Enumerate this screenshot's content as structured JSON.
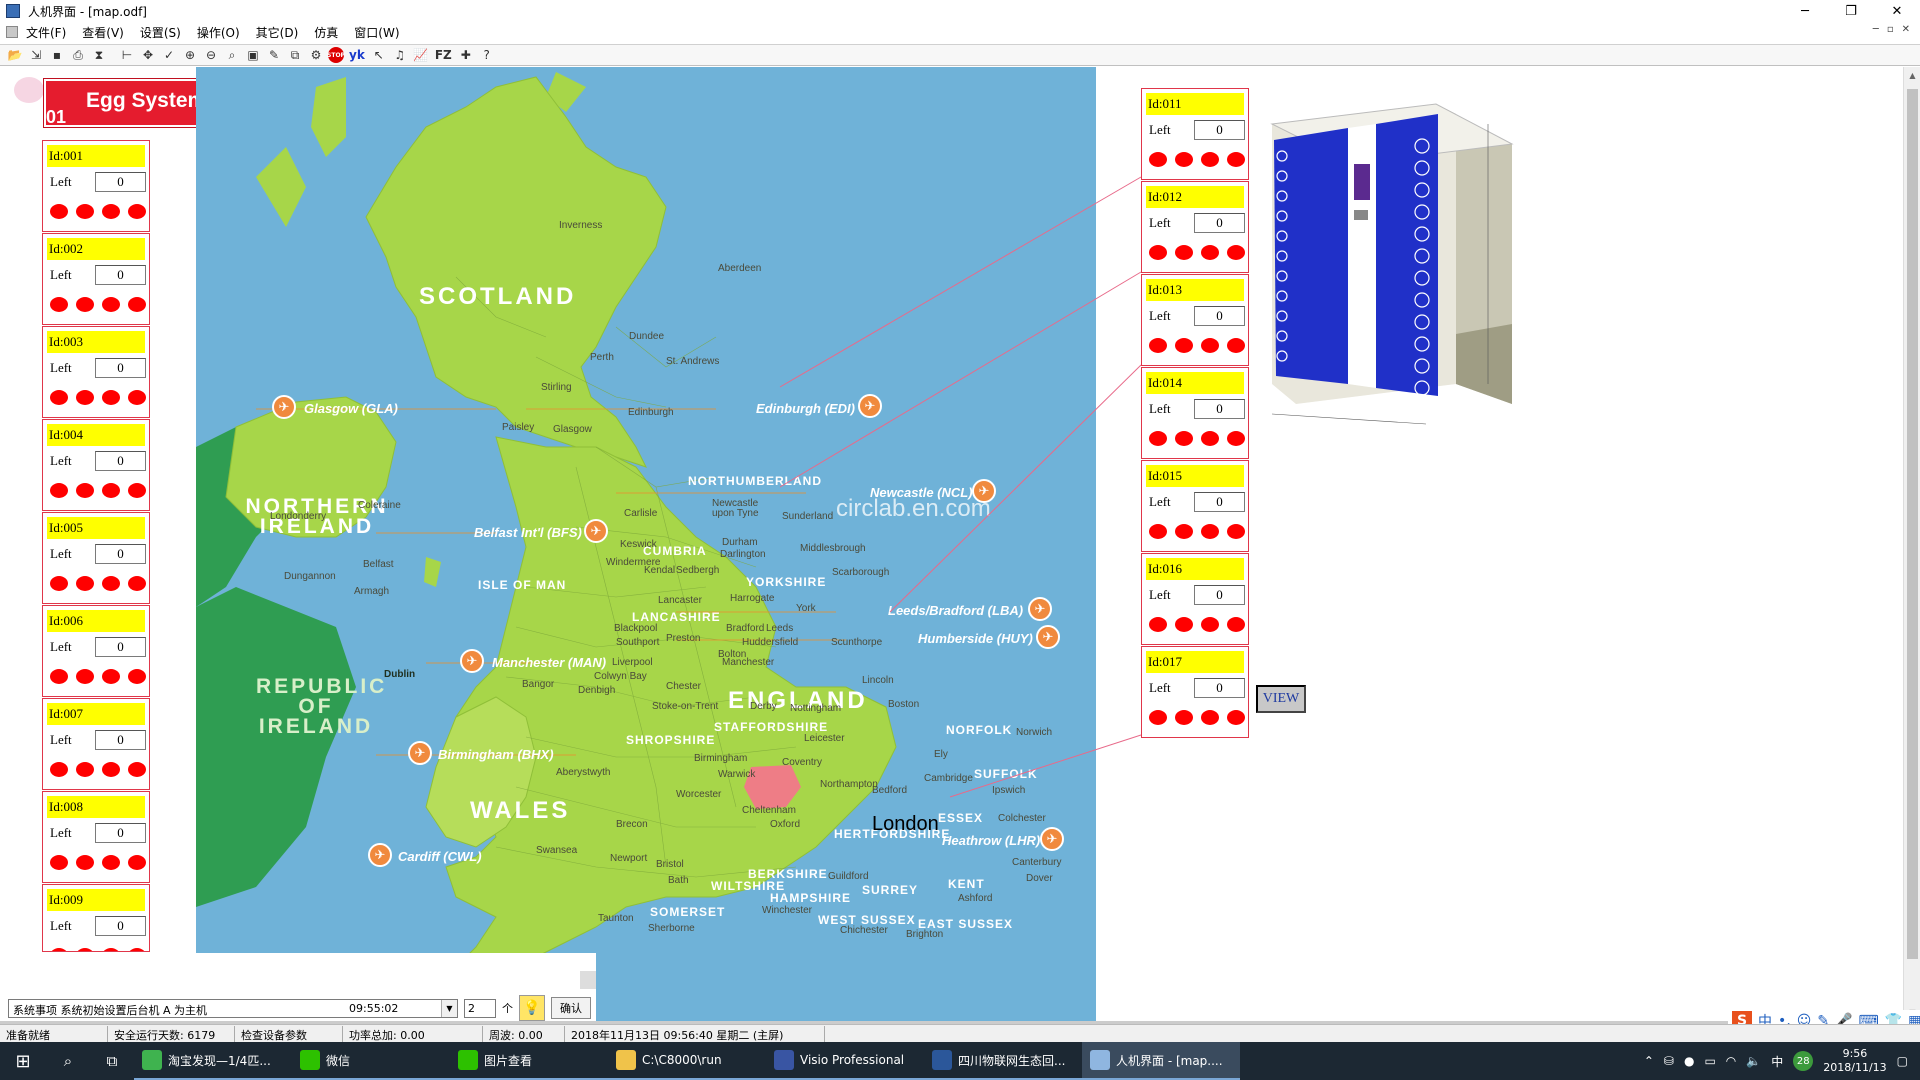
{
  "window": {
    "title": "人机界面 - [map.odf]",
    "controls": [
      "─",
      "❐",
      "✕"
    ]
  },
  "menu": [
    "文件(F)",
    "查看(V)",
    "设置(S)",
    "操作(O)",
    "其它(D)",
    "仿真",
    "窗口(W)"
  ],
  "mdi_controls": [
    "─",
    "▫",
    "✕"
  ],
  "toolbar": {
    "stop_label": "STOP",
    "yk_label": "yk",
    "fz_label": "FZ"
  },
  "logo": {
    "title": "Egg System",
    "badge": "01"
  },
  "left_panels": [
    {
      "id": "Id:001",
      "left_label": "Left",
      "value": "0"
    },
    {
      "id": "Id:002",
      "left_label": "Left",
      "value": "0"
    },
    {
      "id": "Id:003",
      "left_label": "Left",
      "value": "0"
    },
    {
      "id": "Id:004",
      "left_label": "Left",
      "value": "0"
    },
    {
      "id": "Id:005",
      "left_label": "Left",
      "value": "0"
    },
    {
      "id": "Id:006",
      "left_label": "Left",
      "value": "0"
    },
    {
      "id": "Id:007",
      "left_label": "Left",
      "value": "0"
    },
    {
      "id": "Id:008",
      "left_label": "Left",
      "value": "0"
    },
    {
      "id": "Id:009",
      "left_label": "Left",
      "value": "0"
    }
  ],
  "right_panels": [
    {
      "id": "Id:011",
      "left_label": "Left",
      "value": "0"
    },
    {
      "id": "Id:012",
      "left_label": "Left",
      "value": "0"
    },
    {
      "id": "Id:013",
      "left_label": "Left",
      "value": "0"
    },
    {
      "id": "Id:014",
      "left_label": "Left",
      "value": "0"
    },
    {
      "id": "Id:015",
      "left_label": "Left",
      "value": "0"
    },
    {
      "id": "Id:016",
      "left_label": "Left",
      "value": "0"
    },
    {
      "id": "Id:017",
      "left_label": "Left",
      "value": "0"
    }
  ],
  "view_button": "VIEW",
  "map": {
    "countries": [
      "SCOTLAND",
      "NORTHERN IRELAND",
      "REPUBLIC OF IRELAND",
      "WALES",
      "ENGLAND"
    ],
    "regions": [
      "NORTHUMBERLAND",
      "CUMBRIA",
      "YORKSHIRE",
      "LANCASHIRE",
      "ISLE OF MAN",
      "STAFFORDSHIRE",
      "SHROPSHIRE",
      "NORFOLK",
      "SUFFOLK",
      "ESSEX",
      "HERTFORDSHIRE",
      "BERKSHIRE",
      "WILTSHIRE",
      "HAMPSHIRE",
      "SURREY",
      "KENT",
      "SOMERSET",
      "WEST SUSSEX",
      "EAST SUSSEX"
    ],
    "airports": [
      "Glasgow (GLA)",
      "Edinburgh (EDI)",
      "Newcastle (NCL)",
      "Belfast Int'l (BFS)",
      "Leeds/Bradford (LBA)",
      "Humberside (HUY)",
      "Manchester (MAN)",
      "Birmingham (BHX)",
      "Heathrow (LHR)",
      "Cardiff (CWL)"
    ],
    "towns": [
      "Inverness",
      "Aberdeen",
      "Dundee",
      "Perth",
      "St. Andrews",
      "Stirling",
      "Paisley",
      "Glasgow",
      "Edinburgh",
      "Coleraine",
      "Londonderry",
      "Belfast",
      "Dungannon",
      "Armagh",
      "Carlisle",
      "Newcastle upon Tyne",
      "Sunderland",
      "Durham",
      "Middlesbrough",
      "Keswick",
      "Windermere",
      "Kendal",
      "Darlington",
      "Scarborough",
      "Sedbergh",
      "Harrogate",
      "York",
      "Lancaster",
      "Blackpool",
      "Southport",
      "Preston",
      "Bradford",
      "Leeds",
      "Huddersfield",
      "Bolton",
      "Scunthorpe",
      "Liverpool",
      "Manchester",
      "Dublin",
      "Bangor",
      "Colwyn Bay",
      "Denbigh",
      "Chester",
      "Stoke-on-Trent",
      "Derby",
      "Nottingham",
      "Lincoln",
      "Boston",
      "Norwich",
      "Leicester",
      "Ely",
      "Birmingham",
      "Coventry",
      "Warwick",
      "Northampton",
      "Cambridge",
      "Ipswich",
      "Bedford",
      "Aberystwyth",
      "Worcester",
      "Oxford",
      "Cheltenham",
      "Colchester",
      "Brecon",
      "Newport",
      "Swansea",
      "Bristol",
      "Bath",
      "Guildford",
      "Canterbury",
      "Dover",
      "Ashford",
      "Winchester",
      "Taunton",
      "Chichester",
      "Brighton",
      "Sherborne"
    ],
    "city_highlight": "London",
    "watermark": "circlab.en.com"
  },
  "bottom_controls": {
    "combo_text": "系统事项  系统初始设置后台机 A 为主机",
    "combo_time": "09:55:02",
    "spin_value": "2",
    "unit": "个",
    "confirm": "确认"
  },
  "status_bar": [
    "准备就绪",
    "安全运行天数: 6179",
    "检查设备参数",
    "功率总加:  0.00",
    "周波:  0.00",
    "2018年11月13日  09:56:40  星期二  (主屏)"
  ],
  "ime": {
    "s": "S",
    "lang": "中"
  },
  "taskbar": {
    "tasks": [
      "淘宝发现—1/4匹...",
      "微信",
      "图片查看",
      "C:\\C8000\\run",
      "Visio Professional",
      "四川物联网生态回...",
      "人机界面 - [map...."
    ],
    "tray_lang": "中",
    "tray_badge": "28",
    "time": "9:56",
    "date": "2018/11/13"
  }
}
